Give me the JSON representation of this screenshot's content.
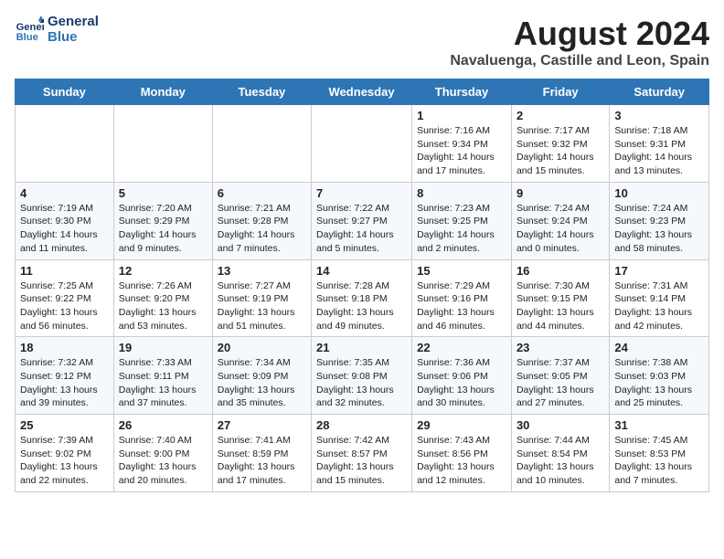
{
  "header": {
    "logo_line1": "General",
    "logo_line2": "Blue",
    "month_year": "August 2024",
    "location": "Navaluenga, Castille and Leon, Spain"
  },
  "days_of_week": [
    "Sunday",
    "Monday",
    "Tuesday",
    "Wednesday",
    "Thursday",
    "Friday",
    "Saturday"
  ],
  "weeks": [
    [
      {
        "day": "",
        "info": ""
      },
      {
        "day": "",
        "info": ""
      },
      {
        "day": "",
        "info": ""
      },
      {
        "day": "",
        "info": ""
      },
      {
        "day": "1",
        "info": "Sunrise: 7:16 AM\nSunset: 9:34 PM\nDaylight: 14 hours\nand 17 minutes."
      },
      {
        "day": "2",
        "info": "Sunrise: 7:17 AM\nSunset: 9:32 PM\nDaylight: 14 hours\nand 15 minutes."
      },
      {
        "day": "3",
        "info": "Sunrise: 7:18 AM\nSunset: 9:31 PM\nDaylight: 14 hours\nand 13 minutes."
      }
    ],
    [
      {
        "day": "4",
        "info": "Sunrise: 7:19 AM\nSunset: 9:30 PM\nDaylight: 14 hours\nand 11 minutes."
      },
      {
        "day": "5",
        "info": "Sunrise: 7:20 AM\nSunset: 9:29 PM\nDaylight: 14 hours\nand 9 minutes."
      },
      {
        "day": "6",
        "info": "Sunrise: 7:21 AM\nSunset: 9:28 PM\nDaylight: 14 hours\nand 7 minutes."
      },
      {
        "day": "7",
        "info": "Sunrise: 7:22 AM\nSunset: 9:27 PM\nDaylight: 14 hours\nand 5 minutes."
      },
      {
        "day": "8",
        "info": "Sunrise: 7:23 AM\nSunset: 9:25 PM\nDaylight: 14 hours\nand 2 minutes."
      },
      {
        "day": "9",
        "info": "Sunrise: 7:24 AM\nSunset: 9:24 PM\nDaylight: 14 hours\nand 0 minutes."
      },
      {
        "day": "10",
        "info": "Sunrise: 7:24 AM\nSunset: 9:23 PM\nDaylight: 13 hours\nand 58 minutes."
      }
    ],
    [
      {
        "day": "11",
        "info": "Sunrise: 7:25 AM\nSunset: 9:22 PM\nDaylight: 13 hours\nand 56 minutes."
      },
      {
        "day": "12",
        "info": "Sunrise: 7:26 AM\nSunset: 9:20 PM\nDaylight: 13 hours\nand 53 minutes."
      },
      {
        "day": "13",
        "info": "Sunrise: 7:27 AM\nSunset: 9:19 PM\nDaylight: 13 hours\nand 51 minutes."
      },
      {
        "day": "14",
        "info": "Sunrise: 7:28 AM\nSunset: 9:18 PM\nDaylight: 13 hours\nand 49 minutes."
      },
      {
        "day": "15",
        "info": "Sunrise: 7:29 AM\nSunset: 9:16 PM\nDaylight: 13 hours\nand 46 minutes."
      },
      {
        "day": "16",
        "info": "Sunrise: 7:30 AM\nSunset: 9:15 PM\nDaylight: 13 hours\nand 44 minutes."
      },
      {
        "day": "17",
        "info": "Sunrise: 7:31 AM\nSunset: 9:14 PM\nDaylight: 13 hours\nand 42 minutes."
      }
    ],
    [
      {
        "day": "18",
        "info": "Sunrise: 7:32 AM\nSunset: 9:12 PM\nDaylight: 13 hours\nand 39 minutes."
      },
      {
        "day": "19",
        "info": "Sunrise: 7:33 AM\nSunset: 9:11 PM\nDaylight: 13 hours\nand 37 minutes."
      },
      {
        "day": "20",
        "info": "Sunrise: 7:34 AM\nSunset: 9:09 PM\nDaylight: 13 hours\nand 35 minutes."
      },
      {
        "day": "21",
        "info": "Sunrise: 7:35 AM\nSunset: 9:08 PM\nDaylight: 13 hours\nand 32 minutes."
      },
      {
        "day": "22",
        "info": "Sunrise: 7:36 AM\nSunset: 9:06 PM\nDaylight: 13 hours\nand 30 minutes."
      },
      {
        "day": "23",
        "info": "Sunrise: 7:37 AM\nSunset: 9:05 PM\nDaylight: 13 hours\nand 27 minutes."
      },
      {
        "day": "24",
        "info": "Sunrise: 7:38 AM\nSunset: 9:03 PM\nDaylight: 13 hours\nand 25 minutes."
      }
    ],
    [
      {
        "day": "25",
        "info": "Sunrise: 7:39 AM\nSunset: 9:02 PM\nDaylight: 13 hours\nand 22 minutes."
      },
      {
        "day": "26",
        "info": "Sunrise: 7:40 AM\nSunset: 9:00 PM\nDaylight: 13 hours\nand 20 minutes."
      },
      {
        "day": "27",
        "info": "Sunrise: 7:41 AM\nSunset: 8:59 PM\nDaylight: 13 hours\nand 17 minutes."
      },
      {
        "day": "28",
        "info": "Sunrise: 7:42 AM\nSunset: 8:57 PM\nDaylight: 13 hours\nand 15 minutes."
      },
      {
        "day": "29",
        "info": "Sunrise: 7:43 AM\nSunset: 8:56 PM\nDaylight: 13 hours\nand 12 minutes."
      },
      {
        "day": "30",
        "info": "Sunrise: 7:44 AM\nSunset: 8:54 PM\nDaylight: 13 hours\nand 10 minutes."
      },
      {
        "day": "31",
        "info": "Sunrise: 7:45 AM\nSunset: 8:53 PM\nDaylight: 13 hours\nand 7 minutes."
      }
    ]
  ]
}
